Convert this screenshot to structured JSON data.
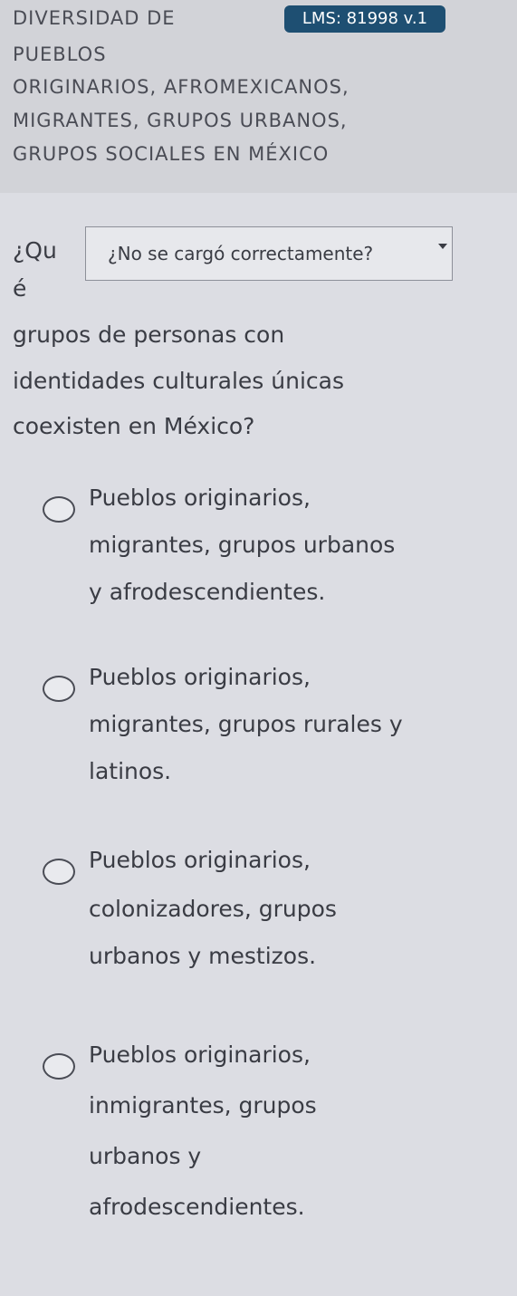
{
  "header": {
    "title_lines": [
      "DIVERSIDAD DE",
      "PUEBLOS",
      "ORIGINARIOS, AFROMEXICANOS,",
      "MIGRANTES, GRUPOS URBANOS,",
      "GRUPOS SOCIALES EN MÉXICO"
    ],
    "badge": "LMS: 81998 v.1"
  },
  "question": {
    "fragment_1": "¿Qu",
    "fragment_2": "é",
    "lines": [
      "grupos de personas con",
      "identidades culturales únicas",
      "coexisten en México?"
    ]
  },
  "dropdown": {
    "label": "¿No se cargó correctamente?",
    "icon": "caret-down-icon"
  },
  "options": [
    {
      "lines": [
        "Pueblos originarios,",
        "migrantes, grupos urbanos",
        "y afrodescendientes."
      ],
      "selected": false
    },
    {
      "lines": [
        "Pueblos originarios,",
        "migrantes, grupos rurales y",
        "latinos."
      ],
      "selected": false
    },
    {
      "lines": [
        "Pueblos originarios,",
        "colonizadores, grupos",
        "urbanos y mestizos."
      ],
      "selected": false
    },
    {
      "lines": [
        "Pueblos originarios,",
        "inmigrantes, grupos",
        "urbanos y",
        "afrodescendientes."
      ],
      "selected": false
    }
  ]
}
